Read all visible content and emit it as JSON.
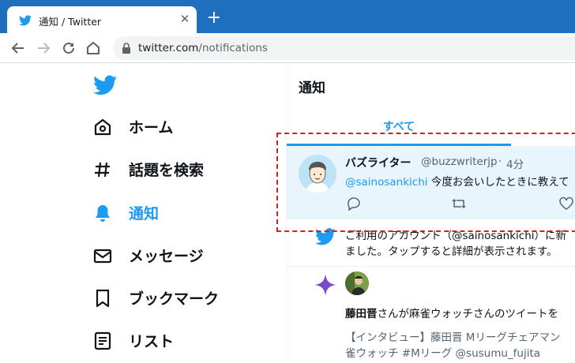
{
  "browser": {
    "tab_title": "通知 / Twitter",
    "tab_close": "✕",
    "new_tab": "+",
    "url_host": "twitter.com",
    "url_path": "/notifications"
  },
  "sidebar": {
    "items": [
      {
        "label": "ホーム",
        "icon": "home-icon"
      },
      {
        "label": "話題を検索",
        "icon": "hashtag-icon"
      },
      {
        "label": "通知",
        "icon": "bell-icon",
        "active": true
      },
      {
        "label": "メッセージ",
        "icon": "envelope-icon"
      },
      {
        "label": "ブックマーク",
        "icon": "bookmark-icon"
      },
      {
        "label": "リスト",
        "icon": "list-icon"
      }
    ]
  },
  "main": {
    "title": "通知",
    "tab_all": "すべて",
    "notifications": [
      {
        "name": "バズライター",
        "handle": "@buzzwriterjp",
        "dot": "·",
        "time": "4分",
        "mention": "@sainosankichi",
        "text": " 今度お会いしたときに教えて"
      },
      {
        "line1": "ご利用のアカウント（@sainosankichi）に新",
        "line2": "ました。タップすると詳細が表示されます。"
      },
      {
        "actor": "藤田晋",
        "action": "さんが麻雀ウォッチさんのツイートを",
        "body1": "【インタビュー】藤田晋 Mリーグチェアマン",
        "body2": "雀ウォッチ #Mリーグ @susumu_fujita"
      }
    ]
  },
  "colors": {
    "twitter_blue": "#1d9bf0",
    "chrome_blue": "#1e6fbe",
    "highlight_red": "#d61f1f",
    "selected_bg": "#e8f5fd",
    "star_purple": "#794bc4"
  }
}
